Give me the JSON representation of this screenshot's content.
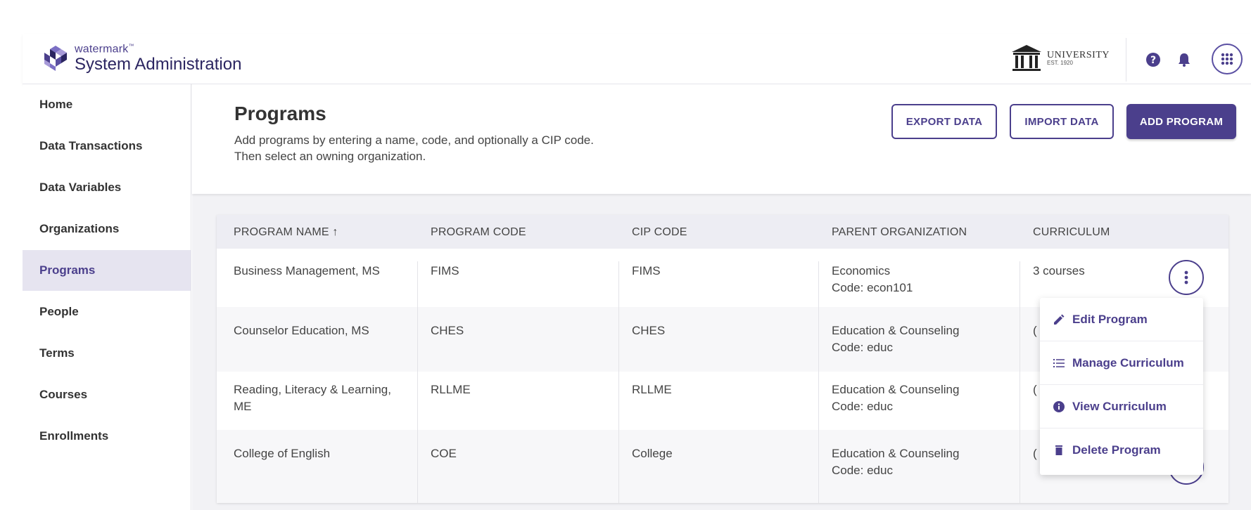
{
  "header": {
    "brand": "watermark",
    "brand_tm": "™",
    "app_title": "System Administration",
    "university_name": "UNIVERSITY",
    "university_est": "EST. 1920"
  },
  "sidebar": {
    "items": [
      {
        "label": "Home"
      },
      {
        "label": "Data Transactions"
      },
      {
        "label": "Data Variables"
      },
      {
        "label": "Organizations"
      },
      {
        "label": "Programs",
        "active": true
      },
      {
        "label": "People"
      },
      {
        "label": "Terms"
      },
      {
        "label": "Courses"
      },
      {
        "label": "Enrollments"
      }
    ]
  },
  "page": {
    "title": "Programs",
    "desc_line1": "Add programs by entering a name, code, and optionally a CIP code.",
    "desc_line2": "Then select an owning organization.",
    "export_label": "EXPORT DATA",
    "import_label": "IMPORT DATA",
    "add_label": "ADD PROGRAM"
  },
  "table": {
    "headers": {
      "program_name": "PROGRAM NAME",
      "sort_indicator": "↑",
      "program_code": "PROGRAM CODE",
      "cip_code": "CIP CODE",
      "parent_org": "PARENT ORGANIZATION",
      "curriculum": "CURRICULUM"
    },
    "rows": [
      {
        "name": "Business Management, MS",
        "code": "FIMS",
        "cip": "FIMS",
        "org": "Economics",
        "org_code": "Code: econ101",
        "curriculum": "3 courses"
      },
      {
        "name": "Counselor Education, MS",
        "code": "CHES",
        "cip": "CHES",
        "org": "Education & Counseling",
        "org_code": "Code: educ",
        "curriculum": "("
      },
      {
        "name_line1": "Reading, Literacy & Learning,",
        "name_line2": "ME",
        "code": "RLLME",
        "cip": "RLLME",
        "org": "Education & Counseling",
        "org_code": "Code: educ",
        "curriculum": "("
      },
      {
        "name": "College of English",
        "code": "COE",
        "cip": "College",
        "org": "Education & Counseling",
        "org_code": "Code: educ",
        "curriculum": "("
      }
    ]
  },
  "menu": {
    "edit": "Edit Program",
    "manage": "Manage Curriculum",
    "view": "View Curriculum",
    "delete": "Delete Program"
  },
  "colors": {
    "accent": "#4b3f8c",
    "active_nav_bg": "#e6e4f0",
    "table_header_bg": "#ededf3"
  }
}
